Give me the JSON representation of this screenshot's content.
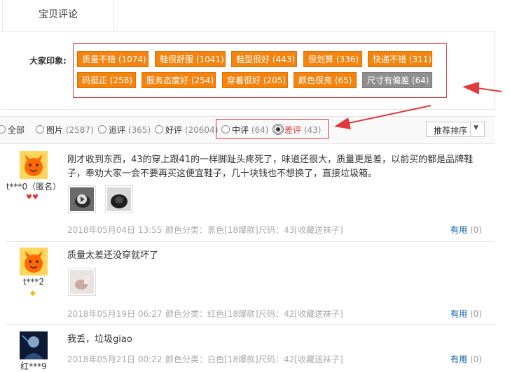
{
  "tab": {
    "label": "宝贝评论"
  },
  "impressions": {
    "label": "大家印象:",
    "tags": [
      {
        "text": "质量不错 (1074)",
        "color": "orange"
      },
      {
        "text": "鞋很舒服 (1041)",
        "color": "orange"
      },
      {
        "text": "鞋型很好 (443)",
        "color": "orange"
      },
      {
        "text": "很划算 (336)",
        "color": "orange"
      },
      {
        "text": "快递不错 (311)",
        "color": "orange"
      },
      {
        "text": "码挺正 (258)",
        "color": "orange"
      },
      {
        "text": "服务态度好 (254)",
        "color": "orange"
      },
      {
        "text": "穿着很好 (205)",
        "color": "orange"
      },
      {
        "text": "颜色很亮 (65)",
        "color": "orange"
      },
      {
        "text": "尺寸有偏差 (64)",
        "color": "gray"
      }
    ]
  },
  "filters": {
    "all": {
      "label": "全部"
    },
    "pictures": {
      "label": "图片",
      "count": "(2587)"
    },
    "followup": {
      "label": "追评",
      "count": "(365)"
    },
    "positive": {
      "label": "好评",
      "count": "(20604)"
    },
    "neutral": {
      "label": "中评",
      "count": "(64)"
    },
    "negative": {
      "label": "差评",
      "count": "(43)",
      "selected": true
    }
  },
  "sort": {
    "label": "推荐排序"
  },
  "colors": {
    "tag_orange": "#f2840f",
    "tag_gray": "#8f8f8f",
    "highlight_red": "#e4393c",
    "link_blue": "#005aa0"
  },
  "reviews": [
    {
      "user": "t***0（匿名）",
      "badge": "hearts",
      "text": "刚才收到东西，43的穿上跟41的一样脚趾头疼死了，味道还很大，质量更是差，以前买的都是品牌鞋子，奉劝大家一会不要再买这便宜鞋子，几十块钱也不想换了，直接垃圾箱。",
      "date": "2018年05月04日 13:55",
      "color_label": "颜色分类：黑色[18爆款]",
      "size_label": "尺码：43[收藏送袜子]",
      "useful": "有用",
      "useful_count": "(0)"
    },
    {
      "user": "t***2",
      "badge": "diamond",
      "text": "质量太差还没穿就坏了",
      "date": "2018年05月19日 06:27",
      "color_label": "颜色分类：红色[18爆款]",
      "size_label": "尺码：42[收藏送袜子]",
      "useful": "有用",
      "useful_count": "(0)"
    },
    {
      "user": "红***9",
      "text": "我丢，垃圾giao",
      "date": "2018年05月21日 00:22",
      "color_label": "颜色分类：白色[18爆款]",
      "size_label": "尺码：42[收藏送袜子]",
      "useful": "有用",
      "useful_count": "(0)"
    }
  ]
}
